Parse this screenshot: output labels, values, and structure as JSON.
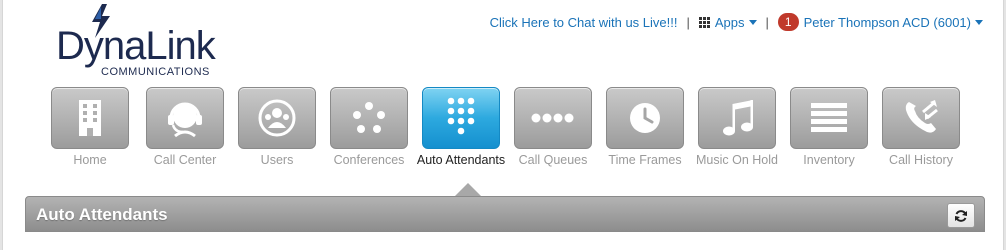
{
  "logo": {
    "wordmark": "DynaLink",
    "tagline": "COMMUNICATIONS"
  },
  "topbar": {
    "chat_link": "Click Here to Chat with us Live!!!",
    "separator": "|",
    "apps_label": "Apps",
    "notification_count": "1",
    "user_label": "Peter Thompson ACD (6001)"
  },
  "nav": {
    "items": [
      {
        "label": "Home",
        "icon": "building-icon"
      },
      {
        "label": "Call Center",
        "icon": "headset-icon"
      },
      {
        "label": "Users",
        "icon": "users-icon"
      },
      {
        "label": "Conferences",
        "icon": "conference-icon"
      },
      {
        "label": "Auto Attendants",
        "icon": "keypad-icon",
        "active": true
      },
      {
        "label": "Call Queues",
        "icon": "queue-dots-icon"
      },
      {
        "label": "Time Frames",
        "icon": "clock-icon"
      },
      {
        "label": "Music On Hold",
        "icon": "music-note-icon"
      },
      {
        "label": "Inventory",
        "icon": "list-icon"
      },
      {
        "label": "Call History",
        "icon": "phone-transfer-icon"
      }
    ]
  },
  "page": {
    "title": "Auto Attendants"
  },
  "colors": {
    "link": "#1a73b8",
    "active_tile": "#2da9df",
    "badge": "#c0392b",
    "logo": "#1d2a4f"
  }
}
